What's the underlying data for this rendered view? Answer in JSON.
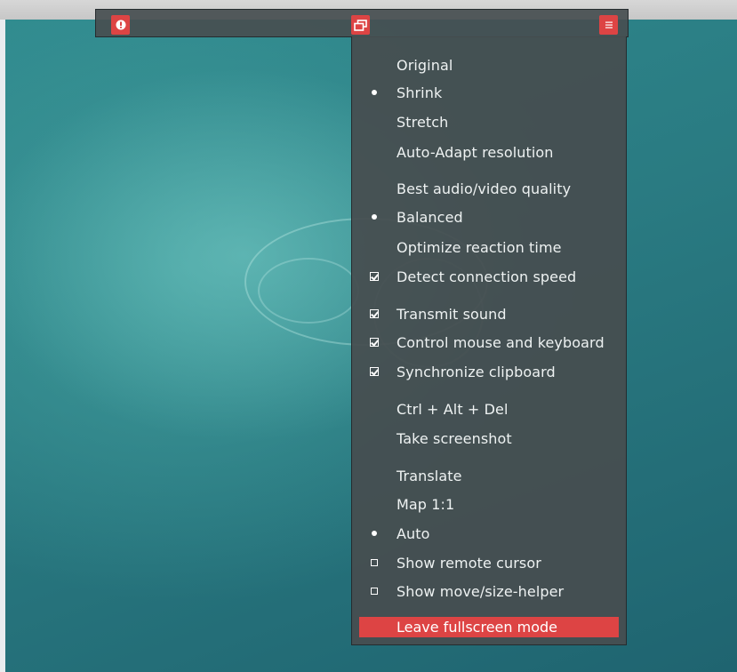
{
  "toolbar": {
    "info_icon": "info-icon",
    "window_icon": "restore-window-icon",
    "menu_icon": "hamburger-menu-icon",
    "accent_color": "#dd4444"
  },
  "menu": {
    "items": [
      {
        "label": "Original",
        "mark": "none"
      },
      {
        "label": "Shrink",
        "mark": "radio-selected"
      },
      {
        "label": "Stretch",
        "mark": "none"
      },
      {
        "label": "Auto-Adapt resolution",
        "mark": "none"
      },
      {
        "label": "Best audio/video quality",
        "mark": "none"
      },
      {
        "label": "Balanced",
        "mark": "radio-selected"
      },
      {
        "label": "Optimize reaction time",
        "mark": "none"
      },
      {
        "label": "Detect connection speed",
        "mark": "checked"
      },
      {
        "label": "Transmit sound",
        "mark": "checked"
      },
      {
        "label": "Control mouse and keyboard",
        "mark": "checked"
      },
      {
        "label": "Synchronize clipboard",
        "mark": "checked"
      },
      {
        "label": "Ctrl + Alt + Del",
        "mark": "none"
      },
      {
        "label": "Take screenshot",
        "mark": "none"
      },
      {
        "label": "Translate",
        "mark": "none"
      },
      {
        "label": "Map 1:1",
        "mark": "none"
      },
      {
        "label": "Auto",
        "mark": "radio-selected"
      },
      {
        "label": "Show remote cursor",
        "mark": "unchecked"
      },
      {
        "label": "Show move/size-helper",
        "mark": "unchecked"
      }
    ],
    "leave_label": "Leave fullscreen mode"
  }
}
